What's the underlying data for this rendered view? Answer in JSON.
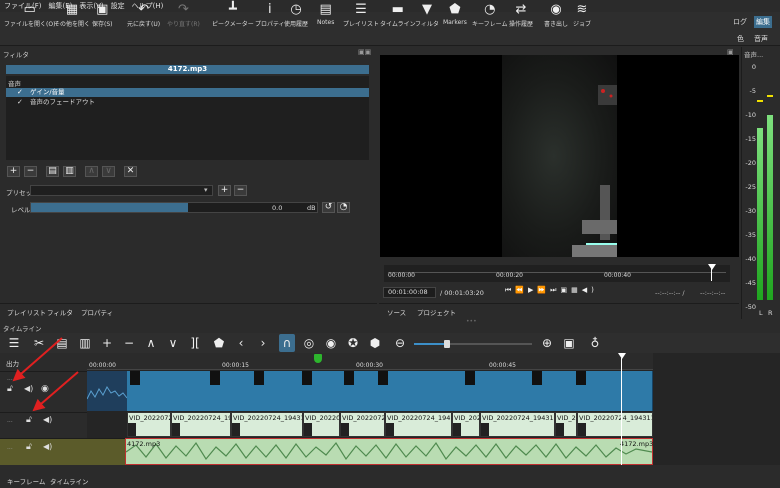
{
  "menu": [
    "ファイル(F)",
    "編集(E)",
    "表示(V)",
    "設定",
    "ヘルプ(H)"
  ],
  "toolbar": [
    {
      "label": "ファイルを開く(O)",
      "icon": "folder-icon",
      "glyph": "▭"
    },
    {
      "label": "その他を開く",
      "icon": "open-other-icon",
      "glyph": "▦"
    },
    {
      "label": "保存(S)",
      "icon": "save-icon",
      "glyph": "▣"
    },
    {
      "label": "元に戻す(U)",
      "icon": "undo-icon",
      "glyph": "↶"
    },
    {
      "label": "やり直す(R)",
      "icon": "redo-icon",
      "glyph": "↷"
    },
    {
      "label": "ピークメーター",
      "icon": "peak-meter-icon",
      "glyph": "┻"
    },
    {
      "label": "プロパティ",
      "icon": "info-icon",
      "glyph": "i"
    },
    {
      "label": "使用履歴",
      "icon": "clock-icon",
      "glyph": "◷"
    },
    {
      "label": "Notes",
      "icon": "notes-icon",
      "glyph": "▤"
    },
    {
      "label": "プレイリスト",
      "icon": "playlist-icon",
      "glyph": "☰"
    },
    {
      "label": "タイムライン",
      "icon": "timeline-icon",
      "glyph": "▬"
    },
    {
      "label": "フィルタ",
      "icon": "filter-icon",
      "glyph": "▼"
    },
    {
      "label": "Markers",
      "icon": "marker-icon",
      "glyph": "⬟"
    },
    {
      "label": "キーフレーム",
      "icon": "stopwatch-icon",
      "glyph": "◔"
    },
    {
      "label": "操作履歴",
      "icon": "history-icon",
      "glyph": "⇄"
    },
    {
      "label": "書き出し",
      "icon": "export-icon",
      "glyph": "◉"
    },
    {
      "label": "ジョブ",
      "icon": "jobs-icon",
      "glyph": "≋"
    }
  ],
  "layout_buttons": {
    "log": "ログ",
    "edit": "編集",
    "color": "色",
    "audio": "音声"
  },
  "filter_panel": {
    "title": "フィルタ",
    "file_name": "4172.mp3",
    "group": "音声",
    "filters": [
      {
        "name": "ゲイン/音量",
        "checked": "✓"
      },
      {
        "name": "音声のフェードアウト",
        "checked": "✓"
      }
    ],
    "preset_label": "プリセット",
    "level_label": "レベル",
    "level_value": "0.0",
    "level_unit": "dB",
    "level_fraction": 0.55,
    "tabs": [
      "プレイリスト",
      "フィルタ",
      "プロパティ"
    ]
  },
  "player": {
    "ruler_marks": [
      "00:00:00",
      "00:00:20",
      "00:00:40"
    ],
    "current_time": "00:01:00:08",
    "total_time": "/ 00:01:03:20",
    "in_point": "--:--:--:-- /",
    "out_point": "--:--:--:--",
    "tabs": [
      "ソース",
      "プロジェクト"
    ]
  },
  "audio_meter": {
    "title": "音声...",
    "scale": [
      "0",
      "-5",
      "-10",
      "-15",
      "-20",
      "-25",
      "-30",
      "-35",
      "-40",
      "-45",
      "-50"
    ],
    "channels": [
      "L",
      "R"
    ]
  },
  "timeline": {
    "title": "タイムライン",
    "output_label": "出力",
    "ruler_marks": [
      "00:00:00",
      "00:00:15",
      "00:00:30",
      "00:00:45"
    ],
    "v2_clips": [
      "VID_20220724_",
      "VID_20220724_194",
      "VID_20220724_19431",
      "VID_20220724",
      "VID_20220724",
      "VID_20220724_194",
      "VID_20220724",
      "VID_20220724_19431",
      "VID_202",
      "VID_20220724_194311"
    ],
    "audio_clip_name": "4172.mp3",
    "audio_clip_name_end": "4172.mp3",
    "bottom_tabs": [
      "キーフレーム",
      "タイムライン"
    ]
  },
  "colors": {
    "accent": "#3c6e8f",
    "video_clip": "#2e7aa8",
    "audio_clip": "#b9dcb2",
    "selected_track": "#5b5b2a",
    "arrow": "#e02020",
    "meter_green": "#2db52d",
    "meter_peak": "#f0e000"
  }
}
